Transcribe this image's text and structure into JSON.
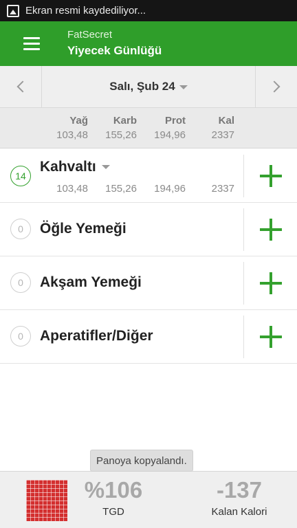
{
  "status_bar": {
    "text": "Ekran resmi kaydediliyor..."
  },
  "app_bar": {
    "app_name": "FatSecret",
    "title": "Yiyecek Günlüğü"
  },
  "date_nav": {
    "date": "Salı, Şub 24"
  },
  "summary": {
    "headers": {
      "fat": "Yağ",
      "carb": "Karb",
      "prot": "Prot",
      "cal": "Kal"
    },
    "values": {
      "fat": "103,48",
      "carb": "155,26",
      "prot": "194,96",
      "cal": "2337"
    }
  },
  "meals": [
    {
      "name": "Kahvaltı",
      "count": "14",
      "fat": "103,48",
      "carb": "155,26",
      "prot": "194,96",
      "cal": "2337"
    },
    {
      "name": "Öğle Yemeği",
      "count": "0"
    },
    {
      "name": "Akşam Yemeği",
      "count": "0"
    },
    {
      "name": "Aperatifler/Diğer",
      "count": "0"
    }
  ],
  "toast": {
    "text": "Panoya kopyalandı."
  },
  "bottom": {
    "rdi_value": "%106",
    "rdi_label": "TGD",
    "remaining_value": "-137",
    "remaining_label": "Kalan Kalori"
  },
  "colors": {
    "brand": "#2f9e2a",
    "accent": "#34a12e",
    "rdi": "#d32f2f"
  }
}
